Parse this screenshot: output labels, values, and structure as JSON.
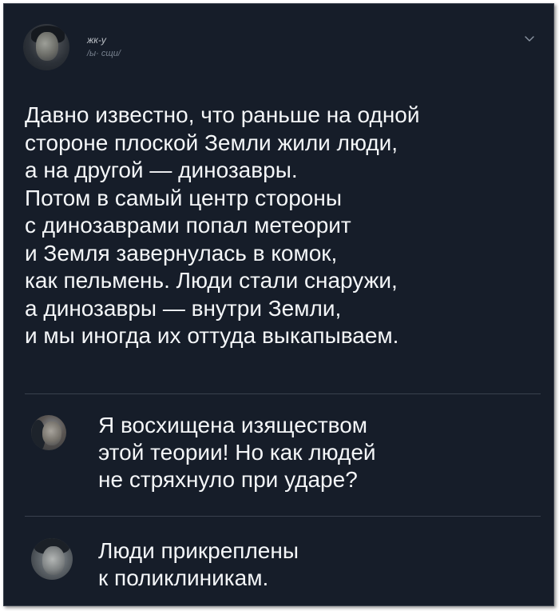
{
  "tweet": {
    "author_name": "жк-у",
    "author_handle": "/ы· сщи/",
    "text": "Давно известно, что раньше на одной\nстороне плоской Земли жили люди,\nа на другой — динозавры.\nПотом в самый центр стороны\nс динозаврами попал метеорит\nи Земля завернулась в комок,\nкак пельмень. Люди стали снаружи,\nа динозавры — внутри Земли,\nи мы иногда их оттуда выкапываем.",
    "menu_icon": "chevron-down-icon"
  },
  "replies": [
    {
      "text": "Я восхищена изяществом\nэтой теории! Но как людей\nне стряхнуло при ударе?",
      "avatar": "avatar"
    },
    {
      "text": "Люди прикреплены\nк поликлиникам.",
      "avatar": "avatar"
    }
  ],
  "colors": {
    "background": "#161d29",
    "text": "#f4f6f8",
    "divider": "#39414e",
    "muted": "#8b95a3"
  }
}
